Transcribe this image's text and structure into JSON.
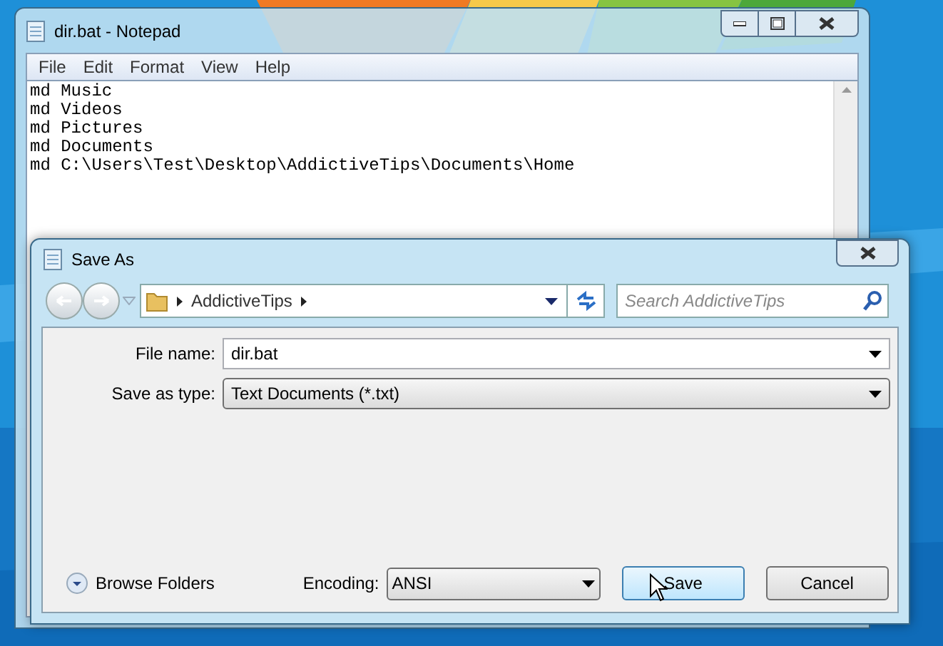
{
  "notepad": {
    "title": "dir.bat - Notepad",
    "menu": [
      "File",
      "Edit",
      "Format",
      "View",
      "Help"
    ],
    "lines": [
      "md Music",
      "md Videos",
      "md Pictures",
      "md Documents",
      "md C:\\Users\\Test\\Desktop\\AddictiveTips\\Documents\\Home"
    ]
  },
  "dialog": {
    "title": "Save As",
    "breadcrumbs": [
      "AddictiveTips"
    ],
    "search": {
      "placeholder": "Search AddictiveTips"
    },
    "fields": [
      {
        "label": "File name:",
        "value": "dir.bat",
        "kind": "editable"
      },
      {
        "label": "Save as type:",
        "value": "Text Documents (*.txt)",
        "kind": "dropdown"
      }
    ],
    "browse_folders": "Browse Folders",
    "encoding": {
      "label": "Encoding:",
      "value": "ANSI"
    },
    "buttons": [
      {
        "label": "Save",
        "kind": "default"
      },
      {
        "label": "Cancel",
        "kind": "normal"
      }
    ]
  }
}
